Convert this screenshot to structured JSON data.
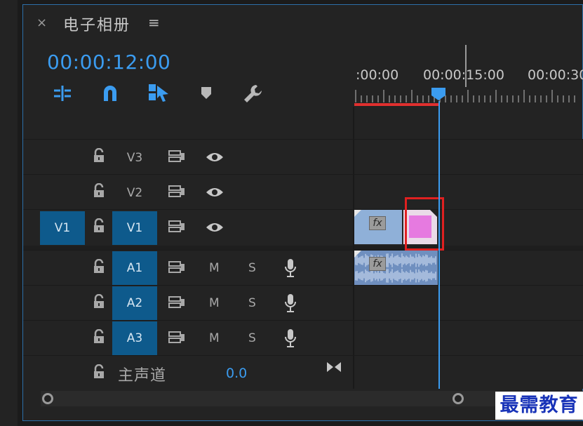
{
  "panel": {
    "close_label": "×",
    "title": "电子相册",
    "menu_label": "≡"
  },
  "timecode": "00:00:12:00",
  "toolbar": {
    "tools": [
      "insert-overwrite-icon",
      "snap-magnet-icon",
      "linked-selection-icon",
      "add-marker-icon",
      "timeline-settings-wrench-icon"
    ]
  },
  "ruler": {
    "labels": [
      ":00:00",
      "00:00:15:00",
      "00:00:30"
    ]
  },
  "tracks": {
    "video": [
      {
        "name": "V3",
        "target": "",
        "active": false
      },
      {
        "name": "V2",
        "target": "",
        "active": false
      },
      {
        "name": "V1",
        "target": "V1",
        "active": true
      }
    ],
    "audio": [
      {
        "name": "A1",
        "mute": "M",
        "solo": "S",
        "active": true
      },
      {
        "name": "A2",
        "mute": "M",
        "solo": "S",
        "active": true
      },
      {
        "name": "A3",
        "mute": "M",
        "solo": "S",
        "active": true
      }
    ],
    "master": {
      "label": "主声道",
      "volume": "0.0"
    }
  },
  "clips": {
    "fx_label": "fx"
  },
  "colors": {
    "accent": "#3b9cf0",
    "highlight_box": "#e02020",
    "work_area": "#e0302f",
    "track_active": "#0e5a8c"
  },
  "watermark": "最需教育"
}
